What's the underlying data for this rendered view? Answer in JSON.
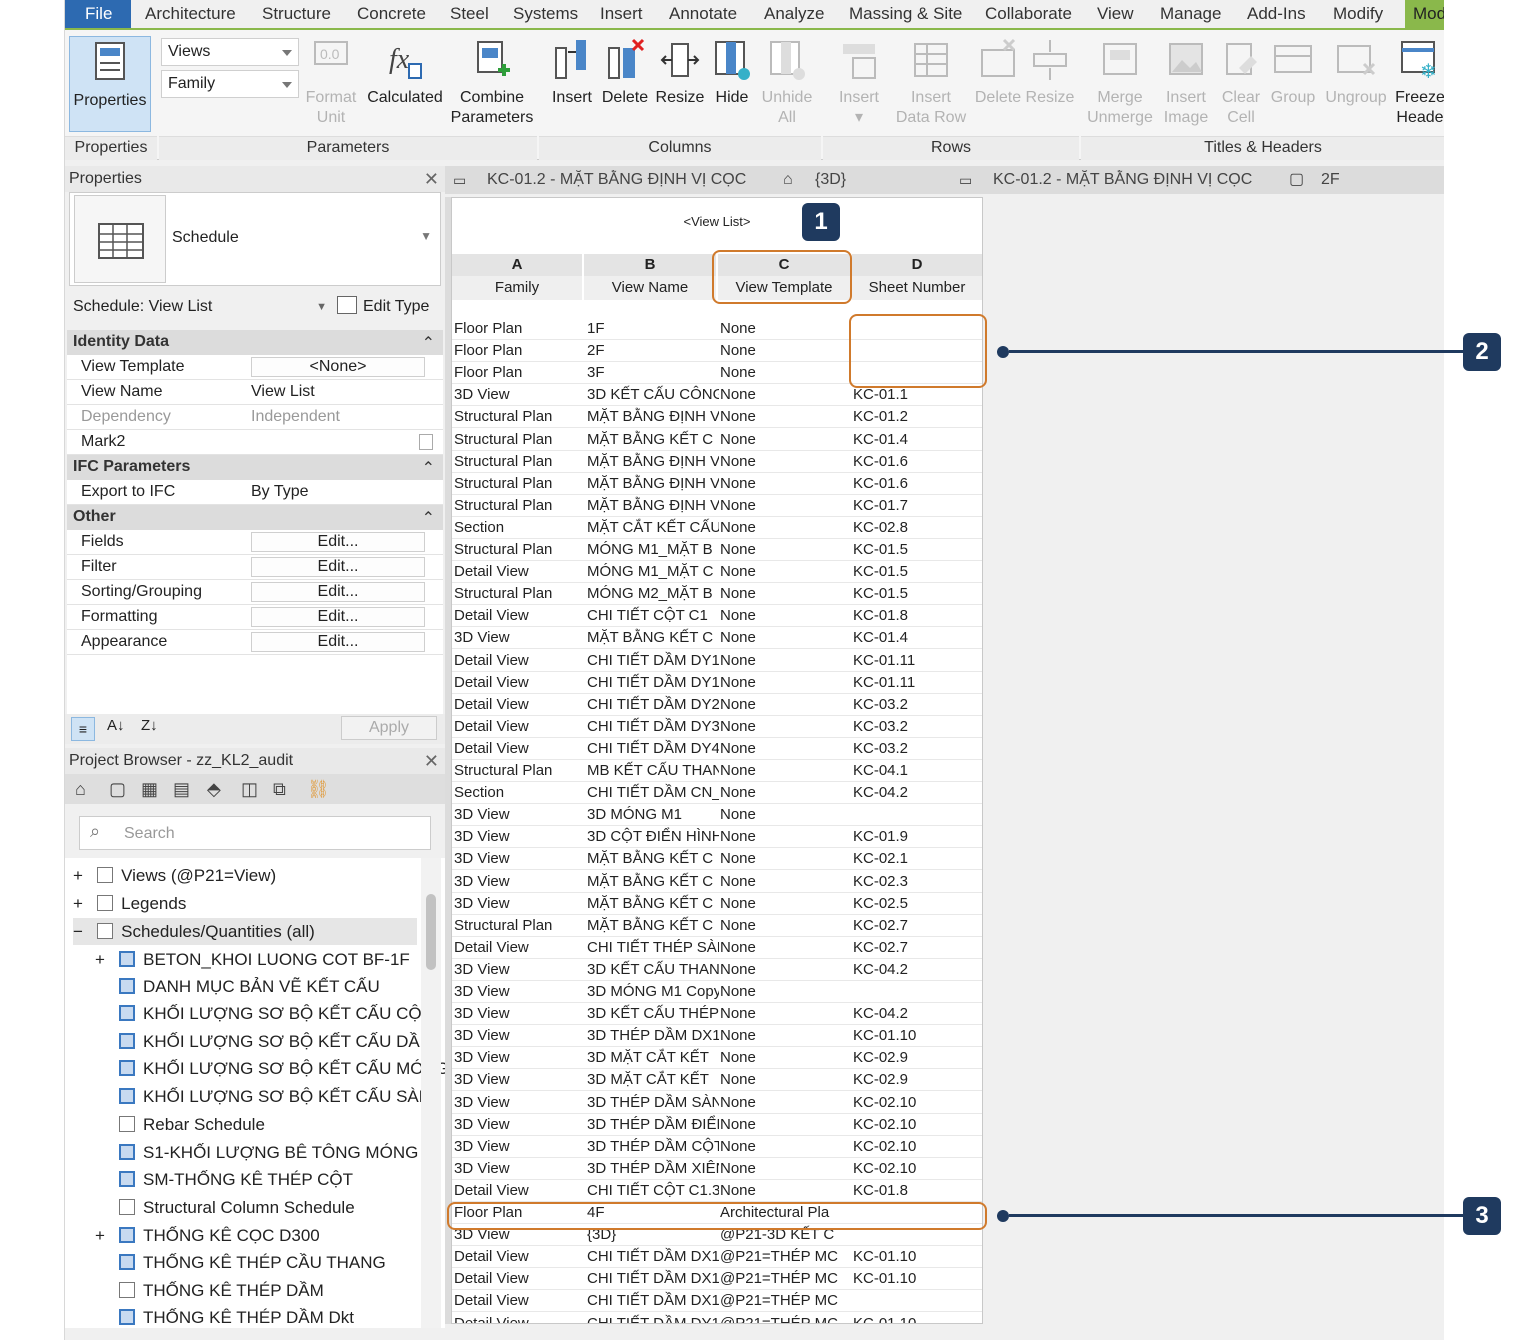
{
  "menu": [
    "File",
    "Architecture",
    "Structure",
    "Concrete",
    "Steel",
    "Systems",
    "Insert",
    "Annotate",
    "Analyze",
    "Massing & Site",
    "Collaborate",
    "View",
    "Manage",
    "Add-Ins",
    "Modify",
    "Mod"
  ],
  "ribbon": {
    "properties_btn": "Properties",
    "views_dd": "Views",
    "family_dd": "Family",
    "buttons": {
      "format_unit": [
        "Format",
        "Unit"
      ],
      "calculated": "Calculated",
      "combine": [
        "Combine",
        "Parameters"
      ],
      "insert": "Insert",
      "delete": "Delete",
      "resize": "Resize",
      "hide": "Hide",
      "unhide": [
        "Unhide",
        "All"
      ],
      "row_insert": "Insert",
      "insert_data_row": [
        "Insert",
        "Data Row"
      ],
      "row_delete": "Delete",
      "row_resize": "Resize",
      "merge": [
        "Merge",
        "Unmerge"
      ],
      "insert_image": [
        "Insert",
        "Image"
      ],
      "clear_cell": [
        "Clear",
        "Cell"
      ],
      "group": "Group",
      "ungroup": "Ungroup",
      "freeze": [
        "Freeze",
        "Heade"
      ]
    },
    "groups": [
      "Properties",
      "Parameters",
      "Columns",
      "Rows",
      "Titles & Headers"
    ]
  },
  "properties": {
    "title": "Properties",
    "type_name": "Schedule",
    "selector": "Schedule: View List",
    "edit_type": "Edit Type",
    "sections": {
      "identity": "Identity Data",
      "ifc": "IFC Parameters",
      "other": "Other"
    },
    "rows": {
      "view_template": [
        "View Template",
        "<None>"
      ],
      "view_name": [
        "View Name",
        "View List"
      ],
      "dependency": [
        "Dependency",
        "Independent"
      ],
      "mark2": [
        "Mark2",
        ""
      ],
      "export_ifc": [
        "Export to IFC",
        "By Type"
      ],
      "fields": [
        "Fields",
        "Edit..."
      ],
      "filter": [
        "Filter",
        "Edit..."
      ],
      "sorting": [
        "Sorting/Grouping",
        "Edit..."
      ],
      "formatting": [
        "Formatting",
        "Edit..."
      ],
      "appearance": [
        "Appearance",
        "Edit..."
      ]
    },
    "apply": "Apply"
  },
  "browser": {
    "title": "Project Browser - zz_KL2_audit",
    "search_placeholder": "Search",
    "items": [
      "Views (@P21=View)",
      "Legends",
      "Schedules/Quantities (all)",
      "BETON_KHOI LUONG COT BF-1F",
      "DANH MỤC BẢN VẼ KẾT CẤU",
      "KHỐI LƯỢNG SƠ BỘ KẾT CẤU CỘT",
      "KHỐI LƯỢNG SƠ BỘ KẾT CẤU DẦM,",
      "KHỐI LƯỢNG SƠ BỘ KẾT CẤU MÓNG",
      "KHỐI LƯỢNG SƠ BỘ KẾT CẤU SÀN",
      "Rebar Schedule",
      "S1-KHỐI LƯỢNG BÊ TÔNG MÓNG",
      "SM-THỐNG KÊ THÉP CỘT",
      "Structural Column Schedule",
      "THỐNG KÊ CỌC D300",
      "THỐNG KÊ THÉP CẦU THANG",
      "THỐNG KÊ THÉP DẦM",
      "THỐNG KÊ THÉP DẦM Dkt"
    ]
  },
  "tabs": [
    "KC-01.2 - MẶT BẰNG ĐỊNH VỊ CỌC",
    "{3D}",
    "KC-01.2 - MẶT BẰNG ĐỊNH VỊ CỌC",
    "2F"
  ],
  "schedule": {
    "title": "<View List>",
    "col_letters": [
      "A",
      "B",
      "C",
      "D"
    ],
    "col_names": [
      "Family",
      "View Name",
      "View Template",
      "Sheet Number"
    ],
    "rows": [
      [
        "Floor Plan",
        "1F",
        "None",
        ""
      ],
      [
        "Floor Plan",
        "2F",
        "None",
        ""
      ],
      [
        "Floor Plan",
        "3F",
        "None",
        ""
      ],
      [
        "3D View",
        "3D KẾT CẤU CÔNG",
        "None",
        "KC-01.1"
      ],
      [
        "Structural Plan",
        "MẶT BẰNG ĐỊNH V",
        "None",
        "KC-01.2"
      ],
      [
        "Structural Plan",
        "MẶT BẰNG KẾT C",
        "None",
        "KC-01.4"
      ],
      [
        "Structural Plan",
        "MẶT BẰNG ĐỊNH V",
        "None",
        "KC-01.6"
      ],
      [
        "Structural Plan",
        "MẶT BẰNG ĐỊNH V",
        "None",
        "KC-01.6"
      ],
      [
        "Structural Plan",
        "MẶT BẰNG ĐỊNH V",
        "None",
        "KC-01.7"
      ],
      [
        "Section",
        "MẶT CẮT KẾT CẤU",
        "None",
        "KC-02.8"
      ],
      [
        "Structural Plan",
        "MÓNG M1_MẶT B",
        "None",
        "KC-01.5"
      ],
      [
        "Detail View",
        "MÓNG M1_MẶT C",
        "None",
        "KC-01.5"
      ],
      [
        "Structural Plan",
        "MÓNG M2_MẶT B",
        "None",
        "KC-01.5"
      ],
      [
        "Detail View",
        "CHI TIẾT CỘT C1",
        "None",
        "KC-01.8"
      ],
      [
        "3D View",
        "MẶT BẰNG KẾT C",
        "None",
        "KC-01.4"
      ],
      [
        "Detail View",
        "CHI TIẾT DẦM DY1.",
        "None",
        "KC-01.11"
      ],
      [
        "Detail View",
        "CHI TIẾT DẦM DY1.",
        "None",
        "KC-01.11"
      ],
      [
        "Detail View",
        "CHI TIẾT DẦM DY2.",
        "None",
        "KC-03.2"
      ],
      [
        "Detail View",
        "CHI TIẾT DẦM DY3.",
        "None",
        "KC-03.2"
      ],
      [
        "Detail View",
        "CHI TIẾT DẦM DY4.",
        "None",
        "KC-03.2"
      ],
      [
        "Structural Plan",
        "MB KẾT CẤU THAN",
        "None",
        "KC-04.1"
      ],
      [
        "Section",
        "CHI TIẾT DẦM CN_",
        "None",
        "KC-04.2"
      ],
      [
        "3D View",
        "3D MÓNG M1",
        "None",
        ""
      ],
      [
        "3D View",
        "3D CỘT ĐIỂN HÌNH",
        "None",
        "KC-01.9"
      ],
      [
        "3D View",
        "MẶT BẰNG KẾT C",
        "None",
        "KC-02.1"
      ],
      [
        "3D View",
        "MẶT BẰNG KẾT C",
        "None",
        "KC-02.3"
      ],
      [
        "3D View",
        "MẶT BẰNG KẾT C",
        "None",
        "KC-02.5"
      ],
      [
        "Structural Plan",
        "MẶT BẰNG KẾT C",
        "None",
        "KC-02.7"
      ],
      [
        "Detail View",
        "CHI TIẾT THÉP SÀN",
        "None",
        "KC-02.7"
      ],
      [
        "3D View",
        "3D KẾT CẤU THAN",
        "None",
        "KC-04.2"
      ],
      [
        "3D View",
        "3D MÓNG M1 Copy",
        "None",
        ""
      ],
      [
        "3D View",
        "3D KẾT CẤU THÉP",
        "None",
        "KC-04.2"
      ],
      [
        "3D View",
        "3D THÉP DẦM DX1.",
        "None",
        "KC-01.10"
      ],
      [
        "3D View",
        "3D MẶT CẮT KẾT",
        "None",
        "KC-02.9"
      ],
      [
        "3D View",
        "3D MẶT CẮT KẾT",
        "None",
        "KC-02.9"
      ],
      [
        "3D View",
        "3D THÉP DẦM SÀN",
        "None",
        "KC-02.10"
      ],
      [
        "3D View",
        "3D THÉP DẦM ĐIỂN",
        "None",
        "KC-02.10"
      ],
      [
        "3D View",
        "3D THÉP DẦM CỘT",
        "None",
        "KC-02.10"
      ],
      [
        "3D View",
        "3D THÉP DẦM XIÊN",
        "None",
        "KC-02.10"
      ],
      [
        "Detail View",
        "CHI TIẾT CỘT C1.3",
        "None",
        "KC-01.8"
      ],
      [
        "Floor Plan",
        "4F",
        "Architectural Pla",
        ""
      ],
      [
        "3D View",
        "{3D}",
        "@P21-3D KẾT C",
        ""
      ],
      [
        "Detail View",
        "CHI TIẾT DẦM DX1.",
        "@P21=THÉP MC",
        "KC-01.10"
      ],
      [
        "Detail View",
        "CHI TIẾT DẦM DX1.",
        "@P21=THÉP MC",
        "KC-01.10"
      ],
      [
        "Detail View",
        "CHI TIẾT DẦM DX1.",
        "@P21=THÉP MC",
        ""
      ],
      [
        "Detail View",
        "CHI TIẾT DẦM DY1.",
        "@P21=THÉP MC",
        "KC-01.10"
      ]
    ]
  },
  "callouts": [
    "1",
    "2",
    "3"
  ]
}
